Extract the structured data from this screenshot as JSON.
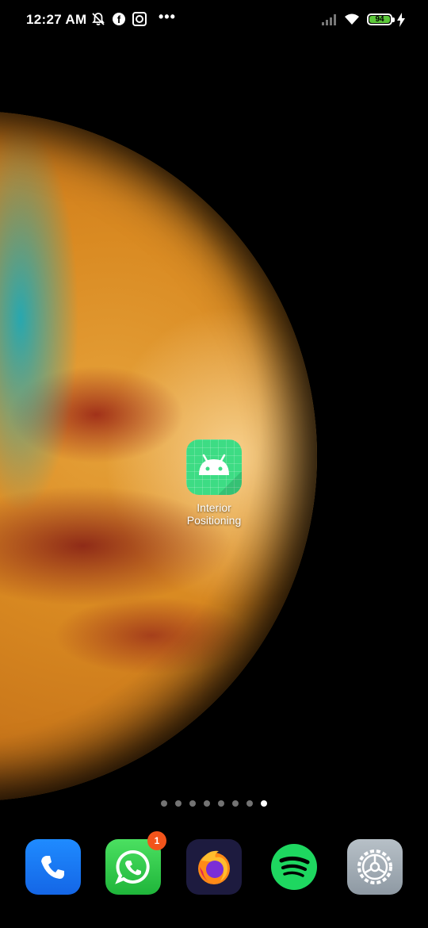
{
  "status_bar": {
    "time": "12:27 AM",
    "battery_level": "94",
    "icons": [
      "bell-off-icon",
      "facebook-icon",
      "instagram-icon",
      "more-icon",
      "signal-icon",
      "wifi-icon",
      "battery-icon",
      "charging-icon"
    ]
  },
  "home": {
    "apps": [
      {
        "label": "Interior Positioning",
        "icon": "android-icon"
      }
    ],
    "page_count": 8,
    "active_page": 8
  },
  "dock": {
    "apps": [
      {
        "icon": "phone-icon",
        "color": "#1a7cf5"
      },
      {
        "icon": "whatsapp-icon",
        "color": "#2fc84a",
        "badge": "1"
      },
      {
        "icon": "firefox-icon",
        "color": "#1d1b3f"
      },
      {
        "icon": "spotify-icon",
        "color": "#1ed760"
      },
      {
        "icon": "settings-icon",
        "color": "#a4aeb6"
      }
    ]
  }
}
